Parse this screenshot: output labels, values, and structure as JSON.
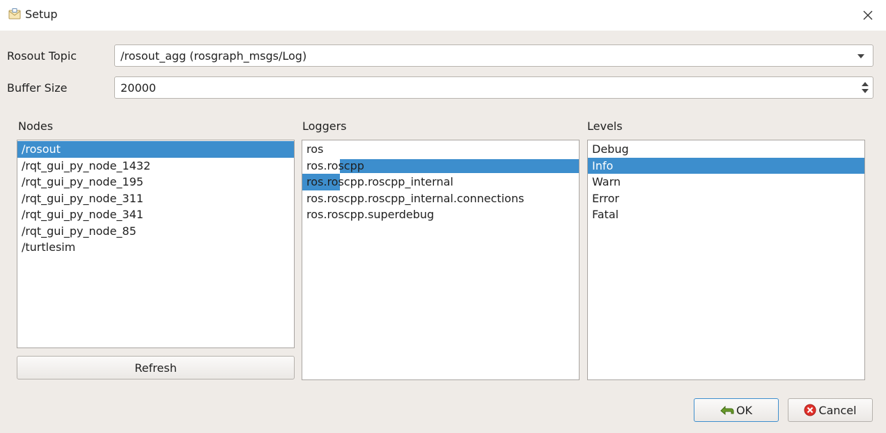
{
  "window": {
    "title": "Setup",
    "app_icon": "envelope-icon",
    "close_icon": "close-icon"
  },
  "form": {
    "rosout_topic_label": "Rosout Topic",
    "rosout_topic_value": "/rosout_agg (rosgraph_msgs/Log)",
    "buffer_size_label": "Buffer Size",
    "buffer_size_value": "20000"
  },
  "nodes": {
    "label": "Nodes",
    "items": [
      "/rosout",
      "/rqt_gui_py_node_1432",
      "/rqt_gui_py_node_195",
      "/rqt_gui_py_node_311",
      "/rqt_gui_py_node_341",
      "/rqt_gui_py_node_85",
      "/turtlesim"
    ],
    "selected": "/rosout",
    "refresh_label": "Refresh"
  },
  "loggers": {
    "label": "Loggers",
    "items": [
      "ros",
      "ros.roscpp",
      "ros.roscpp.roscpp_internal",
      "ros.roscpp.roscpp_internal.connections",
      "ros.roscpp.superdebug"
    ],
    "selected": "ros.roscpp"
  },
  "levels": {
    "label": "Levels",
    "items": [
      "Debug",
      "Info",
      "Warn",
      "Error",
      "Fatal"
    ],
    "selected": "Info"
  },
  "buttons": {
    "ok": "OK",
    "cancel": "Cancel",
    "ok_icon": "checkmark-arrow-icon",
    "cancel_icon": "cancel-icon"
  },
  "colors": {
    "selection": "#3d8ecd",
    "background": "#efebe7"
  }
}
